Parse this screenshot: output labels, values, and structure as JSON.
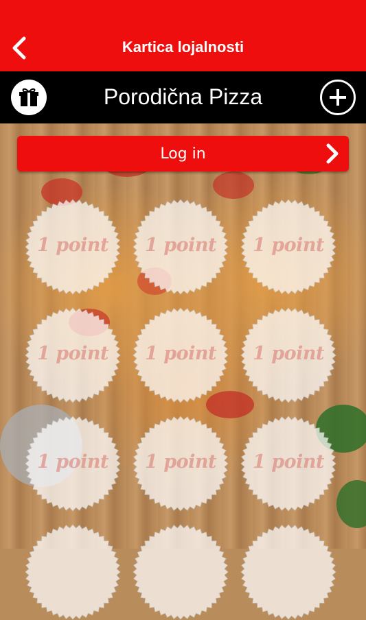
{
  "header": {
    "title": "Kartica lojalnosti",
    "back_icon": "chevron-left-icon",
    "background_color": "#ee0e0e"
  },
  "shop_bar": {
    "name": "Porodična Pizza",
    "gift_icon": "gift-icon",
    "add_icon": "plus-circle-icon",
    "background_color": "#000000"
  },
  "login": {
    "label": "Log in",
    "icon": "chevron-right-icon",
    "background_color": "#ee0e0e"
  },
  "stamps": {
    "label": "1 point",
    "items": [
      {
        "label": "1 point"
      },
      {
        "label": "1 point"
      },
      {
        "label": "1 point"
      },
      {
        "label": "1 point"
      },
      {
        "label": "1 point"
      },
      {
        "label": "1 point"
      },
      {
        "label": "1 point"
      },
      {
        "label": "1 point"
      },
      {
        "label": "1 point"
      }
    ]
  }
}
